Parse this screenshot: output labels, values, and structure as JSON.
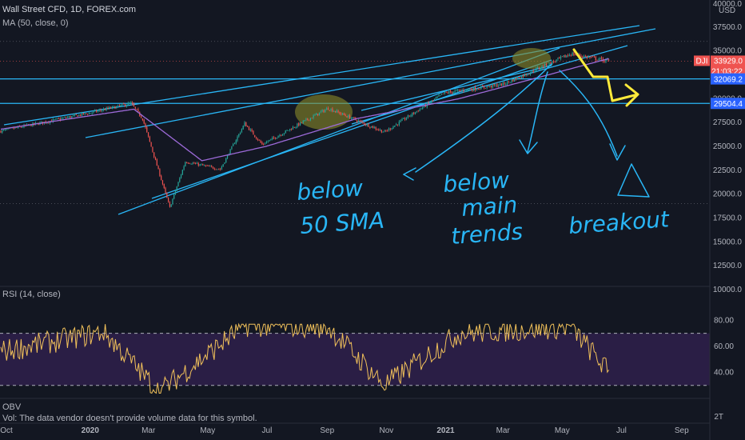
{
  "header": {
    "title": "Wall Street CFD, 1D, FOREX.com",
    "ma_label": "MA (50, close, 0)",
    "currency": "USD"
  },
  "rsi_panel": {
    "label": "RSI (14, close)"
  },
  "obv_panel": {
    "label": "OBV",
    "vol_note": "Vol: The data vendor doesn't provide volume data for this symbol."
  },
  "colors": {
    "background": "#131722",
    "candle_up": "#26a69a",
    "candle_down": "#ef5350",
    "ma_line": "#9c6ad8",
    "trendline": "#29b6f6",
    "highlight": "#8a8a2a",
    "arrow": "#ffeb3b",
    "rsi_line": "#f0c05a",
    "rsi_band": "#2a1e45",
    "axis_text": "#b2b5be",
    "price_tag_red": "#ef5350",
    "price_tag_blue": "#2962ff"
  },
  "price_axis": {
    "ticks": [
      "37500.0",
      "35000.0",
      "32500.0",
      "30000.0",
      "27500.0",
      "25000.0",
      "22500.0",
      "20000.0",
      "17500.0",
      "15000.0",
      "12500.0",
      "10000.0"
    ],
    "top_partial": "40000.0"
  },
  "price_tags": [
    {
      "label": "DJI",
      "value": "33929.0",
      "sub": "21:03:22",
      "color": "#ef5350"
    },
    {
      "value": "32069.2",
      "color": "#2962ff"
    },
    {
      "value": "29504.4",
      "color": "#2962ff"
    }
  ],
  "rsi_axis": {
    "ticks": [
      "80.00",
      "60.00",
      "40.00"
    ]
  },
  "obv_axis": {
    "ticks": [
      "2T"
    ]
  },
  "time_axis": {
    "ticks": [
      "Oct",
      "2020",
      "Mar",
      "May",
      "Jul",
      "Sep",
      "Nov",
      "2021",
      "Mar",
      "May",
      "Jul",
      "Sep"
    ],
    "bold": [
      "2020",
      "2021"
    ]
  },
  "annotations": {
    "note1": [
      "below",
      "50 SMA"
    ],
    "note2": [
      "below",
      "main",
      "trends"
    ],
    "note3": [
      "breakout"
    ]
  },
  "chart_data": {
    "type": "candlestick",
    "timeframe": "1D",
    "title": "Wall Street CFD, 1D, FOREX.com",
    "price_anchors": [
      {
        "date": "2019-10-01",
        "close": 26600
      },
      {
        "date": "2019-12-31",
        "close": 28500
      },
      {
        "date": "2020-02-12",
        "close": 29500
      },
      {
        "date": "2020-02-24",
        "close": 27900
      },
      {
        "date": "2020-03-23",
        "close": 18600
      },
      {
        "date": "2020-04-08",
        "close": 23400
      },
      {
        "date": "2020-05-14",
        "close": 22600
      },
      {
        "date": "2020-06-08",
        "close": 27400
      },
      {
        "date": "2020-06-26",
        "close": 25200
      },
      {
        "date": "2020-09-02",
        "close": 29000
      },
      {
        "date": "2020-10-30",
        "close": 26500
      },
      {
        "date": "2020-12-31",
        "close": 30600
      },
      {
        "date": "2021-03-01",
        "close": 31500
      },
      {
        "date": "2021-05-10",
        "close": 34700
      },
      {
        "date": "2021-06-18",
        "close": 33929
      }
    ],
    "ma50_anchors": [
      {
        "date": "2019-10-01",
        "value": 26800
      },
      {
        "date": "2020-02-15",
        "value": 28900
      },
      {
        "date": "2020-04-25",
        "value": 23500
      },
      {
        "date": "2020-06-30",
        "value": 25000
      },
      {
        "date": "2020-10-01",
        "value": 27900
      },
      {
        "date": "2021-01-15",
        "value": 30000
      },
      {
        "date": "2021-06-18",
        "value": 34200
      }
    ],
    "rsi": {
      "period": 14,
      "levels": [
        70,
        30
      ],
      "ylim": [
        20,
        90
      ],
      "anchors": [
        {
          "date": "2019-10-01",
          "value": 56
        },
        {
          "date": "2020-01-15",
          "value": 71
        },
        {
          "date": "2020-03-12",
          "value": 25
        },
        {
          "date": "2020-06-08",
          "value": 76
        },
        {
          "date": "2020-09-02",
          "value": 75
        },
        {
          "date": "2020-10-30",
          "value": 30
        },
        {
          "date": "2021-01-15",
          "value": 70
        },
        {
          "date": "2021-05-10",
          "value": 75
        },
        {
          "date": "2021-06-18",
          "value": 40
        }
      ]
    },
    "ylim": [
      10000,
      40000
    ],
    "xlim": [
      "2019-10-01",
      "2021-09-30"
    ],
    "grid": false
  }
}
